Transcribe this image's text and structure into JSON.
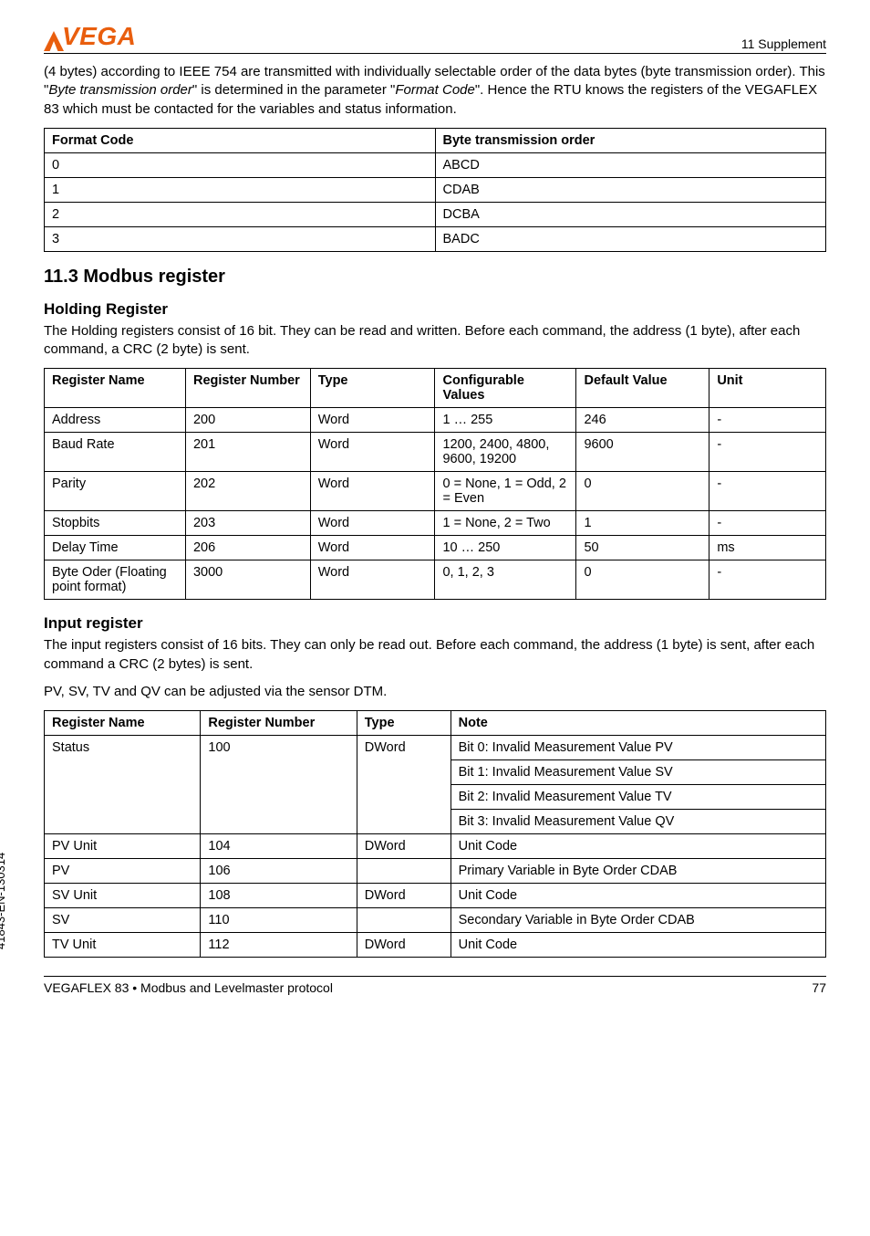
{
  "header": {
    "logo_text": "VEGA",
    "section_label": "11 Supplement"
  },
  "intro_paragraph_1": "(4 bytes) according to IEEE 754 are transmitted with individually selectable order of the data bytes (byte transmission order). This \"",
  "intro_em_1": "Byte transmission order",
  "intro_paragraph_2": "\" is determined in the parameter \"",
  "intro_em_2": "Format Code",
  "intro_paragraph_3": "\". Hence the RTU knows the registers of the VEGAFLEX 83 which must be contacted for the variables and status information.",
  "table1": {
    "headers": [
      "Format Code",
      "Byte transmission order"
    ],
    "rows": [
      [
        "0",
        "ABCD"
      ],
      [
        "1",
        "CDAB"
      ],
      [
        "2",
        "DCBA"
      ],
      [
        "3",
        "BADC"
      ]
    ]
  },
  "section_11_3": {
    "title": "11.3  Modbus register"
  },
  "holding": {
    "title": "Holding Register",
    "desc": "The Holding registers consist of 16 bit. They can be read and written. Before each command, the address (1 byte), after each command, a CRC (2 byte) is sent.",
    "headers": [
      "Register Name",
      "Register Num­ber",
      "Type",
      "Configurable Values",
      "Default Value",
      "Unit"
    ],
    "rows": [
      [
        "Address",
        "200",
        "Word",
        "1 … 255",
        "246",
        "-"
      ],
      [
        "Baud Rate",
        "201",
        "Word",
        "1200, 2400, 4800, 9600, 19200",
        "9600",
        "-"
      ],
      [
        "Parity",
        "202",
        "Word",
        "0 = None, 1 = Odd, 2 = Even",
        "0",
        "-"
      ],
      [
        "Stopbits",
        "203",
        "Word",
        "1 = None, 2 = Two",
        "1",
        "-"
      ],
      [
        "Delay Time",
        "206",
        "Word",
        "10 … 250",
        "50",
        "ms"
      ],
      [
        "Byte Oder (Float­ing point format)",
        "3000",
        "Word",
        "0, 1, 2, 3",
        "0",
        "-"
      ]
    ]
  },
  "input": {
    "title": "Input register",
    "desc": "The input registers consist of 16 bits. They can only be read out. Before each command, the ad­dress (1 byte) is sent, after each command a CRC (2 bytes) is sent.",
    "desc2": "PV, SV, TV and QV can be adjusted via the sensor DTM.",
    "headers": [
      "Register Name",
      "Register Number",
      "Type",
      "Note"
    ],
    "status_row": {
      "name": "Status",
      "num": "100",
      "type": "DWord",
      "notes": [
        "Bit 0: Invalid Measurement Value PV",
        "Bit 1: Invalid Measurement Value SV",
        "Bit 2: Invalid Measurement Value TV",
        "Bit 3: Invalid Measurement Value QV"
      ]
    },
    "other_rows": [
      [
        "PV Unit",
        "104",
        "DWord",
        "Unit Code"
      ],
      [
        "PV",
        "106",
        "",
        "Primary Variable in Byte Order CDAB"
      ],
      [
        "SV Unit",
        "108",
        "DWord",
        "Unit Code"
      ],
      [
        "SV",
        "110",
        "",
        "Secondary Variable in Byte Order CDAB"
      ],
      [
        "TV Unit",
        "112",
        "DWord",
        "Unit Code"
      ]
    ]
  },
  "side_doc_id": "41843-EN-130314",
  "footer": {
    "left": "VEGAFLEX 83 • Modbus and Levelmaster protocol",
    "right": "77"
  }
}
